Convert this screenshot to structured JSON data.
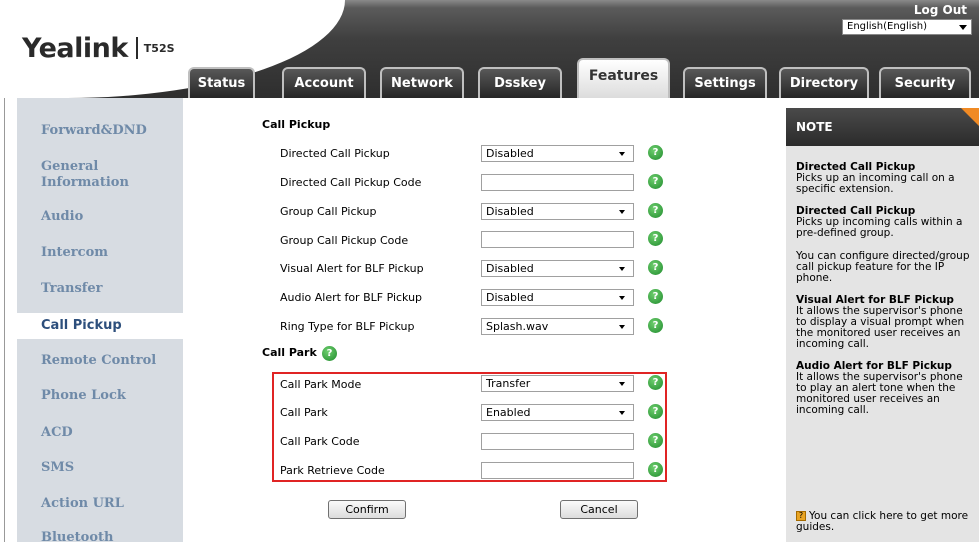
{
  "header": {
    "logo": "Yealink",
    "model": "T52S",
    "logout": "Log Out",
    "language": "English(English)"
  },
  "tabs": [
    "Status",
    "Account",
    "Network",
    "Dsskey",
    "Features",
    "Settings",
    "Directory",
    "Security"
  ],
  "active_tab": "Features",
  "sidebar": {
    "items": [
      "Forward&DND",
      "General Information",
      "Audio",
      "Intercom",
      "Transfer",
      "Call Pickup",
      "Remote Control",
      "Phone Lock",
      "ACD",
      "SMS",
      "Action URL",
      "Bluetooth"
    ],
    "active": "Call Pickup"
  },
  "main": {
    "call_pickup_title": "Call Pickup",
    "call_park_title": "Call Park",
    "fields": {
      "directed_pickup": {
        "label": "Directed Call Pickup",
        "value": "Disabled"
      },
      "directed_pickup_code": {
        "label": "Directed Call Pickup Code",
        "value": ""
      },
      "group_pickup": {
        "label": "Group Call Pickup",
        "value": "Disabled"
      },
      "group_pickup_code": {
        "label": "Group Call Pickup Code",
        "value": ""
      },
      "visual_alert": {
        "label": "Visual Alert for BLF Pickup",
        "value": "Disabled"
      },
      "audio_alert": {
        "label": "Audio Alert for BLF Pickup",
        "value": "Disabled"
      },
      "ring_type": {
        "label": "Ring Type for BLF Pickup",
        "value": "Splash.wav"
      },
      "park_mode": {
        "label": "Call Park Mode",
        "value": "Transfer"
      },
      "call_park": {
        "label": "Call Park",
        "value": "Enabled"
      },
      "park_code": {
        "label": "Call Park Code",
        "value": ""
      },
      "retrieve_code": {
        "label": "Park Retrieve Code",
        "value": ""
      }
    },
    "confirm": "Confirm",
    "cancel": "Cancel"
  },
  "note": {
    "title": "NOTE",
    "h1": "Directed Call Pickup",
    "t1": "Picks up an incoming call on a specific extension.",
    "h2": "Directed Call Pickup",
    "t2": "Picks up incoming calls within a pre-defined group.",
    "t3": "You can configure directed/group call pickup feature for the IP phone.",
    "h4": "Visual Alert for BLF Pickup",
    "t4": "It allows the supervisor's phone to display a visual prompt when the monitored user receives an incoming call.",
    "h5": "Audio Alert for BLF Pickup",
    "t5": "It allows the supervisor's phone to play an alert tone when the monitored user receives an incoming call.",
    "t6": "You can click here to get more guides."
  },
  "help_glyph": "?",
  "colors": {
    "accent_orange": "#f08a24",
    "highlight_red": "#e02424",
    "sidebar_bg": "#d7dce2"
  }
}
